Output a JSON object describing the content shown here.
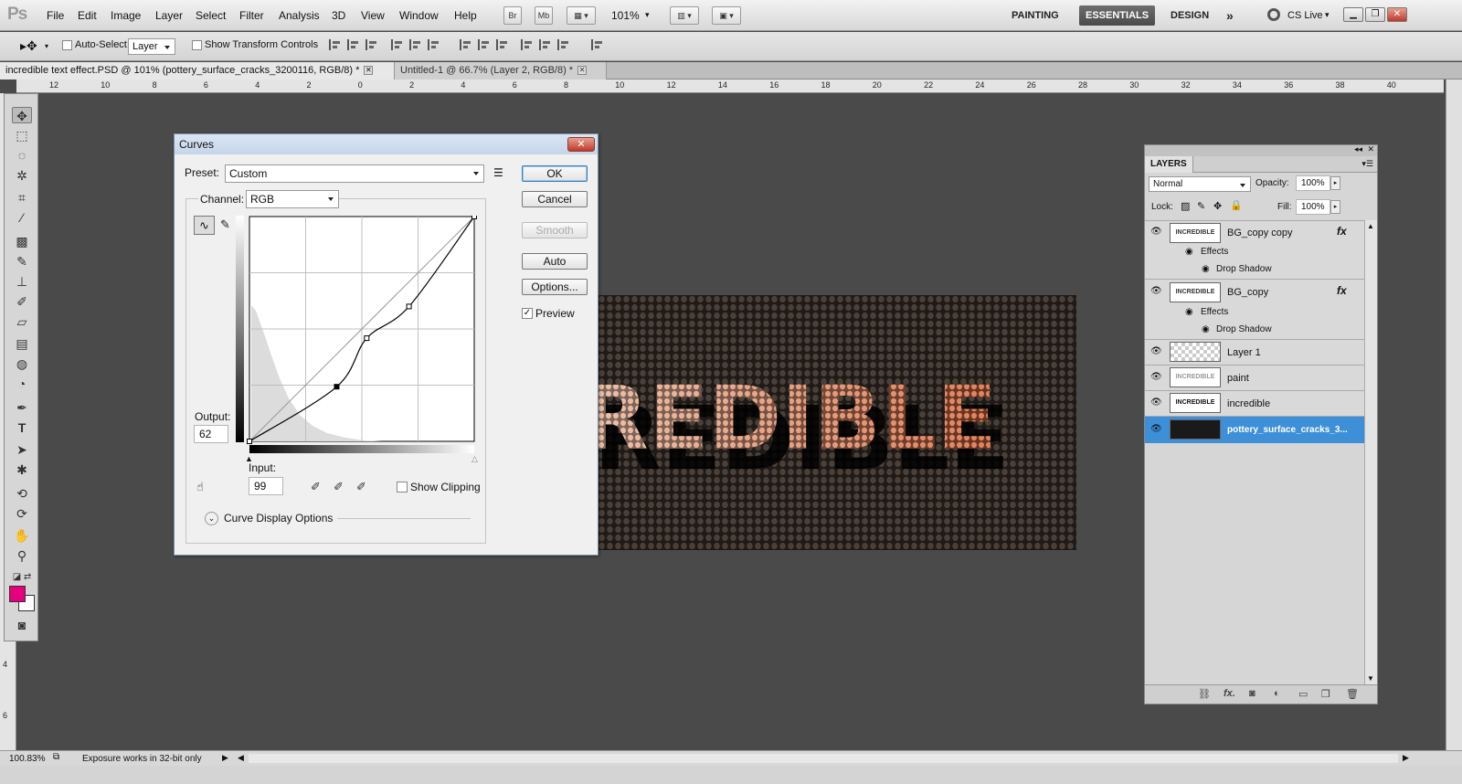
{
  "app": {
    "logo": "Ps"
  },
  "menu": [
    "File",
    "Edit",
    "Image",
    "Layer",
    "Select",
    "Filter",
    "Analysis",
    "3D",
    "View",
    "Window",
    "Help"
  ],
  "appbar": {
    "bridge": "Br",
    "minibridge": "Mb",
    "zoom": "101%",
    "workspaces": [
      "PAINTING",
      "ESSENTIALS",
      "DESIGN"
    ],
    "more": "»",
    "cslive": "CS Live"
  },
  "options": {
    "auto_select_label": "Auto-Select:",
    "auto_select_value": "Layer",
    "show_transform": "Show Transform Controls"
  },
  "tabs": [
    {
      "label": "incredible text effect.PSD @ 101% (pottery_surface_cracks_3200116, RGB/8) *",
      "active": true
    },
    {
      "label": "Untitled-1 @ 66.7% (Layer 2, RGB/8) *",
      "active": false
    }
  ],
  "ruler_h": [
    "12",
    "10",
    "8",
    "6",
    "4",
    "2",
    "0",
    "2",
    "4",
    "6",
    "8",
    "10",
    "12",
    "14",
    "16",
    "18",
    "20",
    "22",
    "24",
    "26",
    "28",
    "30",
    "32",
    "34",
    "36",
    "38",
    "40"
  ],
  "ruler_v": [
    "4",
    "6"
  ],
  "colors": {
    "foreground": "#e6007e",
    "background": "#ffffff",
    "selection": "#3d8fd8"
  },
  "canvas": {
    "text": "REDIBLE"
  },
  "curves": {
    "title": "Curves",
    "close": "✕",
    "preset_label": "Preset:",
    "preset_value": "Custom",
    "channel_label": "Channel:",
    "channel_value": "RGB",
    "output_label": "Output:",
    "output_value": "62",
    "input_label": "Input:",
    "input_value": "99",
    "show_clipping": "Show Clipping",
    "curve_display": "Curve Display Options",
    "buttons": {
      "ok": "OK",
      "cancel": "Cancel",
      "smooth": "Smooth",
      "auto": "Auto",
      "options": "Options..."
    },
    "preview_label": "Preview",
    "preview_checked": "✓",
    "points": [
      [
        0,
        0
      ],
      [
        99,
        62
      ],
      [
        133,
        117
      ],
      [
        181,
        153
      ],
      [
        255,
        255
      ]
    ]
  },
  "layers": {
    "tab": "LAYERS",
    "blend": "Normal",
    "opacity_label": "Opacity:",
    "opacity": "100%",
    "lock_label": "Lock:",
    "fill_label": "Fill:",
    "fill": "100%",
    "effects_label": "Effects",
    "drop_shadow": "Drop Shadow",
    "fx": "fx",
    "thumb_text": "INCREDIBLE",
    "items": [
      {
        "name": "BG_copy copy"
      },
      {
        "name": "BG_copy"
      },
      {
        "name": "Layer 1"
      },
      {
        "name": "paint"
      },
      {
        "name": "incredible"
      },
      {
        "name": "pottery_surface_cracks_3..."
      }
    ]
  },
  "status": {
    "zoom": "100.83%",
    "message": "Exposure works in 32-bit only"
  }
}
